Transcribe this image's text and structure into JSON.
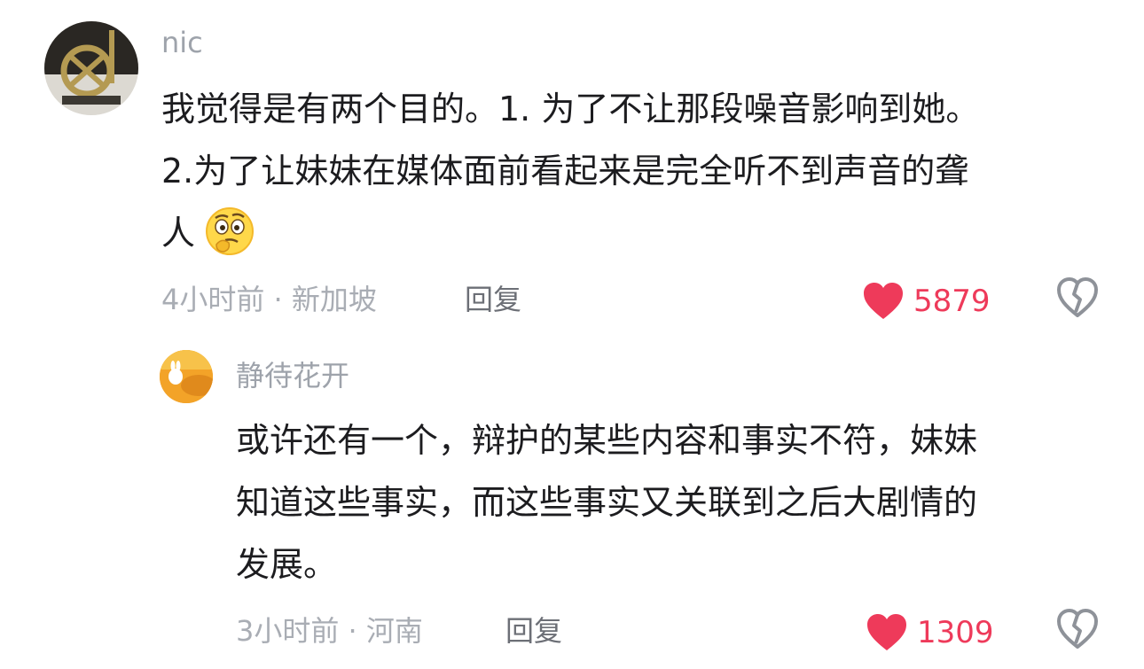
{
  "comment": {
    "username": "nic",
    "lines": [
      "我觉得是有两个目的。1. 为了不让那段噪音影响到她。",
      "2.为了让妹妹在媒体面前看起来是完全听不到声音的聋",
      "人"
    ],
    "emoji": "thinking-face-icon",
    "time_location": "4小时前 · 新加坡",
    "reply_label": "回复",
    "likes": "5879"
  },
  "reply": {
    "username": "静待花开",
    "lines": [
      "或许还有一个，辩护的某些内容和事实不符，妹妹",
      "知道这些事实，而这些事实又关联到之后大剧情的",
      "发展。"
    ],
    "time_location": "3小时前 · 河南",
    "reply_label": "回复",
    "likes": "1309"
  },
  "colors": {
    "like_red": "#ee3a5a",
    "meta_gray": "#a9adb4",
    "text_dark": "#1c1c1f"
  }
}
